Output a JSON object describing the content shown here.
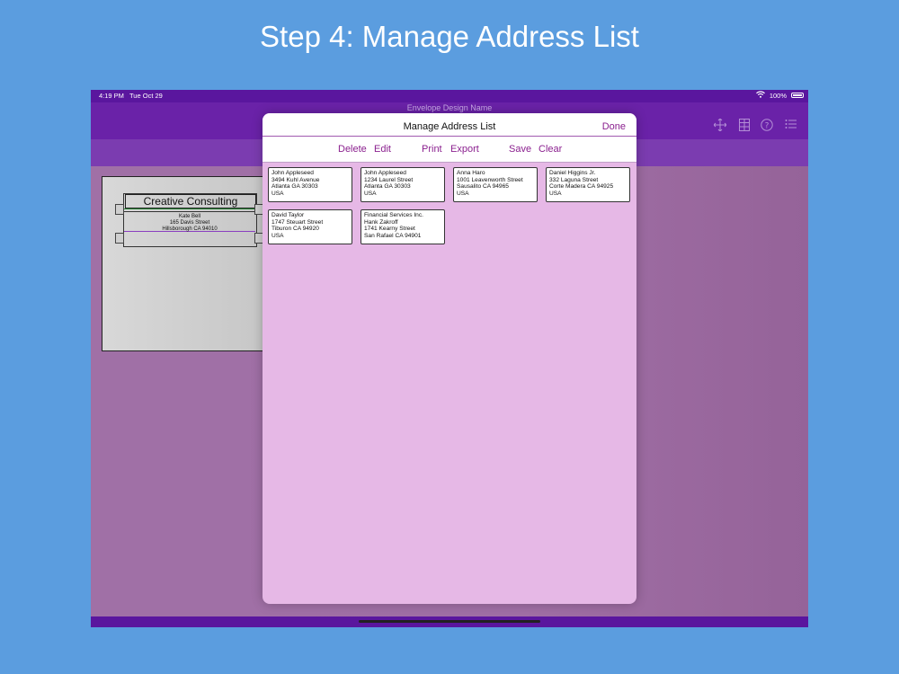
{
  "headline": "Step 4: Manage Address List",
  "status_bar": {
    "time": "4:19 PM",
    "date": "Tue Oct 29",
    "battery": "100%"
  },
  "nav": {
    "title": "Envelope Design Name"
  },
  "icons": [
    "move-icon",
    "grid-icon",
    "help-icon",
    "list-icon"
  ],
  "envelope": {
    "company": "Creative Consulting",
    "recipient": [
      "Kate Bell",
      "165 Davis Street",
      "Hillsborough CA 94010"
    ]
  },
  "modal": {
    "title": "Manage Address List",
    "done": "Done",
    "toolbar": {
      "delete": "Delete",
      "edit": "Edit",
      "print": "Print",
      "export": "Export",
      "save": "Save",
      "clear": "Clear"
    },
    "addresses": [
      {
        "line1": "John Appleseed",
        "line2": "3494 Kuhl Avenue",
        "line3": "Atlanta GA 30303",
        "line4": "USA"
      },
      {
        "line1": "John Appleseed",
        "line2": "1234 Laurel Street",
        "line3": "Atlanta GA 30303",
        "line4": "USA"
      },
      {
        "line1": "Anna Haro",
        "line2": "1001  Leavenworth Street",
        "line3": "Sausalito CA 94965",
        "line4": "USA"
      },
      {
        "line1": "Daniel Higgins Jr.",
        "line2": "332 Laguna Street",
        "line3": "Corte Madera CA 94925",
        "line4": "USA"
      },
      {
        "line1": "David Taylor",
        "line2": "1747 Steuart Street",
        "line3": "Tiburon CA 94920",
        "line4": "USA"
      },
      {
        "line1": "Financial Services Inc.",
        "line2": "Hank Zakroff",
        "line3": "1741 Kearny Street",
        "line4": "San Rafael CA 94901"
      }
    ]
  },
  "colors": {
    "background": "#5b9ddf",
    "nav": "#6a22a8",
    "accent": "#8a1f8e",
    "modal_bg": "#e6b8e6"
  }
}
